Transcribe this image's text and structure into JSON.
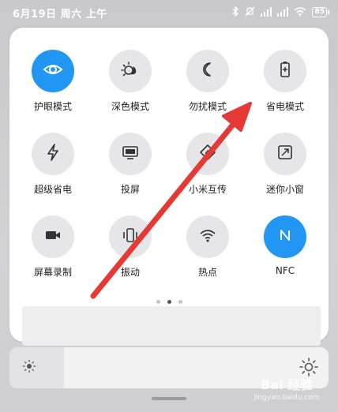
{
  "status_bar": {
    "time": "6月19日 周六 上午",
    "battery": "85",
    "icons": [
      "bluetooth-icon",
      "mute-icon",
      "signal-icon",
      "signal-icon",
      "wifi-icon",
      "battery-icon"
    ]
  },
  "control_center": {
    "tiles": [
      {
        "label": "护眼模式",
        "icon": "eye-icon",
        "active": true
      },
      {
        "label": "深色模式",
        "icon": "dark-mode-icon",
        "active": false
      },
      {
        "label": "勿扰模式",
        "icon": "moon-icon",
        "active": false
      },
      {
        "label": "省电模式",
        "icon": "battery-saver-icon",
        "active": false
      },
      {
        "label": "超级省电",
        "icon": "bolt-icon",
        "active": false
      },
      {
        "label": "投屏",
        "icon": "screen-cast-icon",
        "active": false
      },
      {
        "label": "小米互传",
        "icon": "share-icon",
        "active": false
      },
      {
        "label": "迷你小窗",
        "icon": "mini-window-icon",
        "active": false
      },
      {
        "label": "屏幕录制",
        "icon": "video-camera-icon",
        "active": false
      },
      {
        "label": "振动",
        "icon": "vibrate-icon",
        "active": false
      },
      {
        "label": "热点",
        "icon": "hotspot-icon",
        "active": false
      },
      {
        "label": "NFC",
        "icon": "nfc-icon",
        "active": true
      }
    ],
    "page_indicator": {
      "count": 3,
      "current": 2
    }
  },
  "brightness": {
    "level": 0.17
  },
  "watermark": {
    "brand": "Bai 经验",
    "url": "jingyan.baidu.com"
  },
  "colors": {
    "accent": "#2196f3",
    "arrow": "#e53935"
  }
}
